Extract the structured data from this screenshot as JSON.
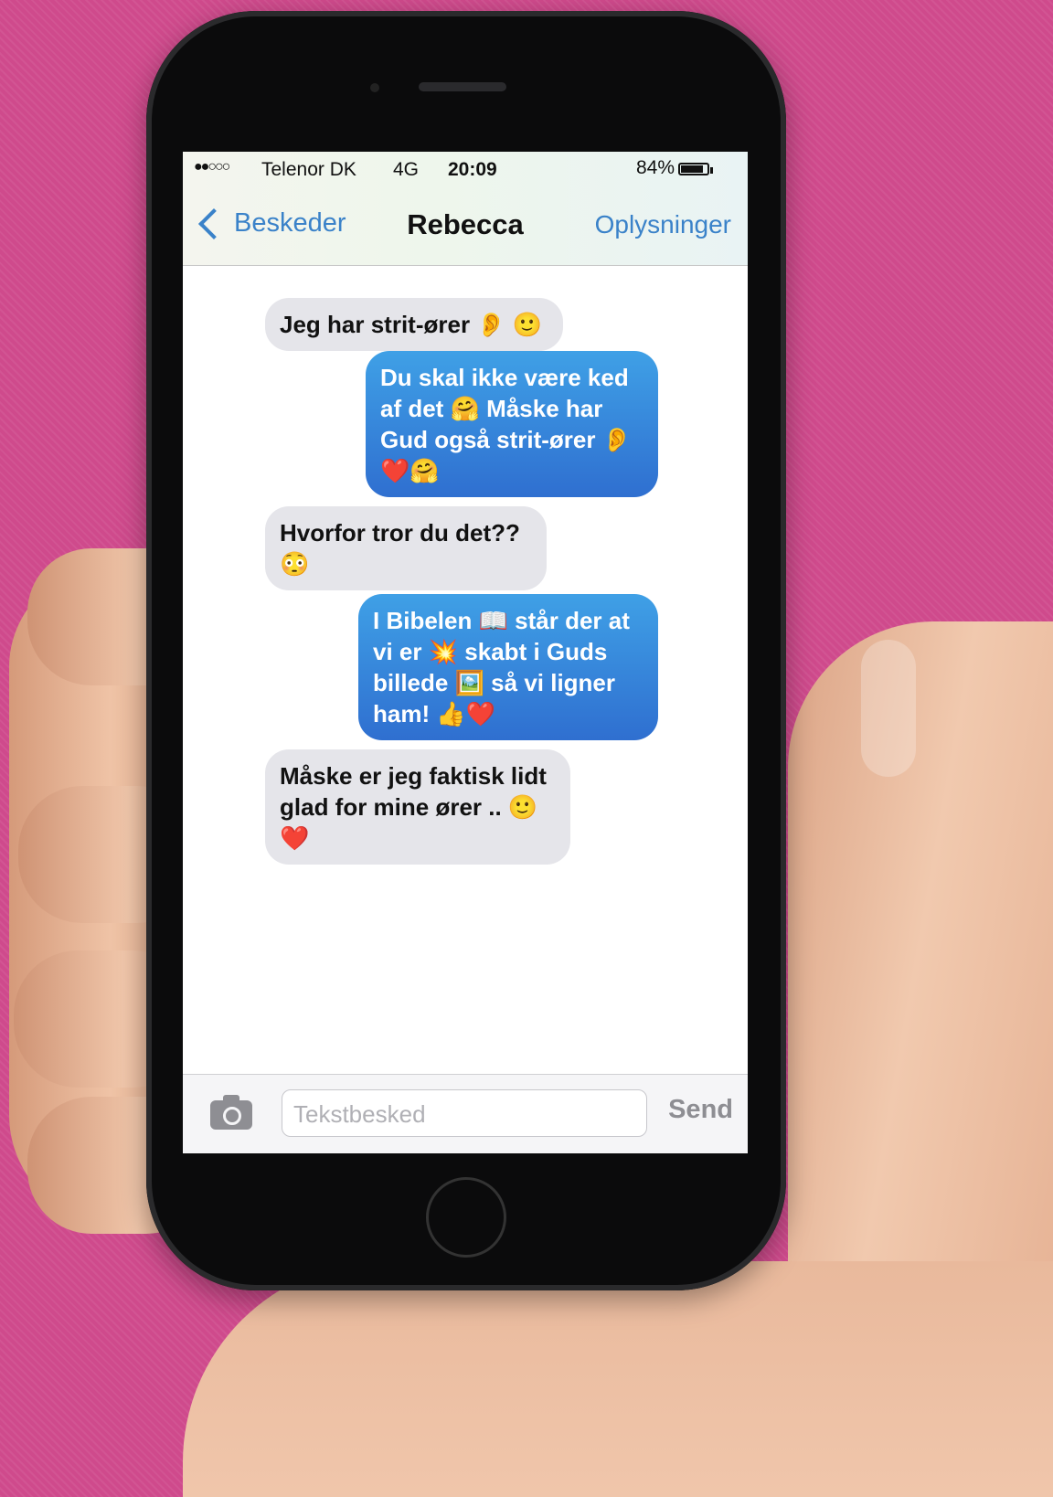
{
  "status_bar": {
    "signal": "●●○○○",
    "carrier": "Telenor DK",
    "network": "4G",
    "time": "20:09",
    "battery": "84%",
    "battery_level": 0.84
  },
  "nav": {
    "back_label": "Beskeder",
    "title": "Rebecca",
    "info_label": "Oplysninger"
  },
  "messages": [
    {
      "direction": "incoming",
      "text": "Jeg har strit-ører 👂 🙂"
    },
    {
      "direction": "outgoing",
      "text": "Du skal ikke være ked af det 🤗 Måske har Gud også strit-ører 👂 ❤️🤗"
    },
    {
      "direction": "incoming",
      "text": "Hvorfor tror du det?? 😳"
    },
    {
      "direction": "outgoing",
      "text": "I Bibelen 📖 står der at vi er 💥 skabt i Guds billede 🖼️ så vi ligner ham! 👍❤️"
    },
    {
      "direction": "incoming",
      "text": "Måske er jeg faktisk lidt glad for mine ører .. 🙂❤️"
    }
  ],
  "composer": {
    "placeholder": "Tekstbesked",
    "send_label": "Send"
  },
  "colors": {
    "background": "#cf4a8c",
    "link": "#3a82c9",
    "outgoing_bubble": "#2f6fd0",
    "incoming_bubble": "#e5e5ea"
  }
}
